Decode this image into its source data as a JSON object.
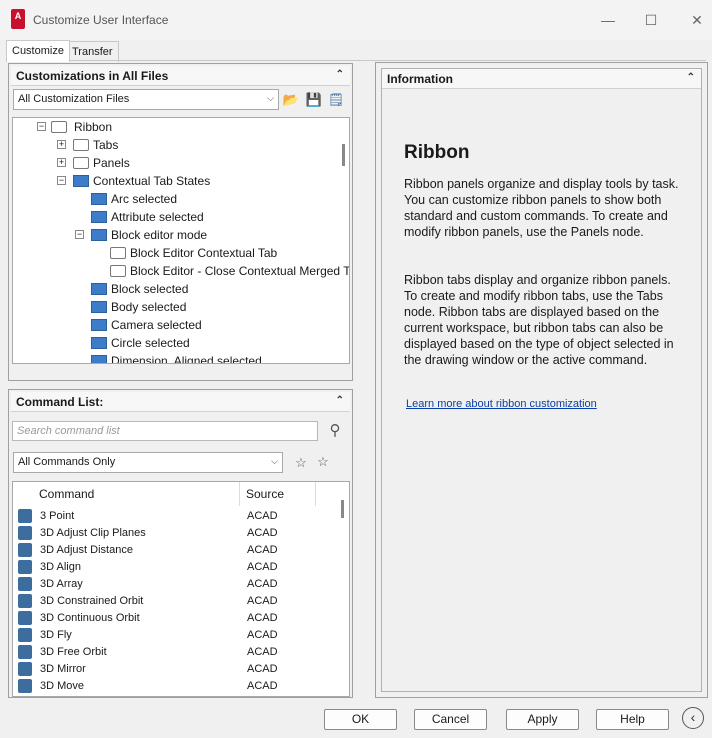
{
  "window": {
    "title": "Customize User Interface",
    "app_icon": "A"
  },
  "tabs": [
    {
      "label": "Customize"
    },
    {
      "label": "Transfer"
    }
  ],
  "customizations": {
    "header": "Customizations in All Files",
    "file_select": "All Customization Files",
    "tree": [
      {
        "label": "Ribbon",
        "icon": "folder-icon"
      },
      {
        "label": "Tabs",
        "icon": "folder-icon"
      },
      {
        "label": "Panels",
        "icon": "folder-icon"
      },
      {
        "label": "Contextual Tab States",
        "icon": "blue-icon"
      },
      {
        "label": "Arc selected",
        "icon": "blue-icon"
      },
      {
        "label": "Attribute selected",
        "icon": "blue-icon"
      },
      {
        "label": "Block editor mode",
        "icon": "blue-icon"
      },
      {
        "label": "Block Editor Contextual Tab",
        "icon": "folder-icon"
      },
      {
        "label": "Block Editor - Close Contextual Merged Tab",
        "icon": "folder-icon"
      },
      {
        "label": "Block selected",
        "icon": "blue-icon"
      },
      {
        "label": "Body selected",
        "icon": "blue-icon"
      },
      {
        "label": "Camera selected",
        "icon": "blue-icon"
      },
      {
        "label": "Circle selected",
        "icon": "blue-icon"
      },
      {
        "label": "Dimension, Aligned selected",
        "icon": "blue-icon"
      }
    ]
  },
  "commands": {
    "header": "Command List:",
    "search_placeholder": "Search command list",
    "filter_select": "All Commands Only",
    "columns": [
      "Command",
      "Source"
    ],
    "rows": [
      {
        "name": "3 Point",
        "source": "ACAD"
      },
      {
        "name": "3D Adjust Clip Planes",
        "source": "ACAD"
      },
      {
        "name": "3D Adjust Distance",
        "source": "ACAD"
      },
      {
        "name": "3D Align",
        "source": "ACAD"
      },
      {
        "name": "3D Array",
        "source": "ACAD"
      },
      {
        "name": "3D Constrained Orbit",
        "source": "ACAD"
      },
      {
        "name": "3D Continuous Orbit",
        "source": "ACAD"
      },
      {
        "name": "3D Fly",
        "source": "ACAD"
      },
      {
        "name": "3D Free Orbit",
        "source": "ACAD"
      },
      {
        "name": "3D Mirror",
        "source": "ACAD"
      },
      {
        "name": "3D Move",
        "source": "ACAD"
      }
    ]
  },
  "info": {
    "header": "Information",
    "title": "Ribbon",
    "para1": "Ribbon panels organize and display tools by task. You can customize ribbon panels to show both standard and custom commands. To create and modify ribbon panels, use the Panels node.",
    "para2": "Ribbon tabs display and organize ribbon panels. To create and modify ribbon tabs, use the Tabs node. Ribbon tabs are displayed based on the current workspace, but ribbon tabs can also be displayed based on the type of object selected in the drawing window or the active command.",
    "link": "Learn more about ribbon customization"
  },
  "buttons": {
    "ok": "OK",
    "cancel": "Cancel",
    "apply": "Apply",
    "help": "Help"
  }
}
